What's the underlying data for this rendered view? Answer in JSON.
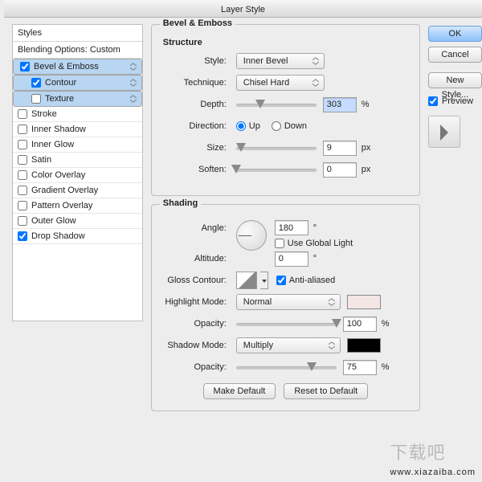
{
  "title": "Layer Style",
  "styles": {
    "head": "Styles",
    "blending": "Blending Options: Custom",
    "items": [
      {
        "label": "Bevel & Emboss",
        "checked": true,
        "sel": true
      },
      {
        "label": "Contour",
        "checked": true,
        "sel": true,
        "indent": 1
      },
      {
        "label": "Texture",
        "checked": false,
        "sel": true,
        "indent": 1
      },
      {
        "label": "Stroke",
        "checked": false
      },
      {
        "label": "Inner Shadow",
        "checked": false
      },
      {
        "label": "Inner Glow",
        "checked": false
      },
      {
        "label": "Satin",
        "checked": false
      },
      {
        "label": "Color Overlay",
        "checked": false
      },
      {
        "label": "Gradient Overlay",
        "checked": false
      },
      {
        "label": "Pattern Overlay",
        "checked": false
      },
      {
        "label": "Outer Glow",
        "checked": false
      },
      {
        "label": "Drop Shadow",
        "checked": true
      }
    ]
  },
  "bevel": {
    "group": "Bevel & Emboss",
    "structure": {
      "title": "Structure",
      "style_label": "Style:",
      "style_value": "Inner Bevel",
      "technique_label": "Technique:",
      "technique_value": "Chisel Hard",
      "depth_label": "Depth:",
      "depth_value": "303",
      "depth_unit": "%",
      "direction_label": "Direction:",
      "up": "Up",
      "down": "Down",
      "direction_value": "up",
      "size_label": "Size:",
      "size_value": "9",
      "size_unit": "px",
      "soften_label": "Soften:",
      "soften_value": "0",
      "soften_unit": "px"
    },
    "shading": {
      "title": "Shading",
      "angle_label": "Angle:",
      "angle_value": "180",
      "deg": "°",
      "use_global": "Use Global Light",
      "use_global_checked": false,
      "altitude_label": "Altitude:",
      "altitude_value": "0",
      "gloss_label": "Gloss Contour:",
      "aa": "Anti-aliased",
      "aa_checked": true,
      "highlight_label": "Highlight Mode:",
      "highlight_value": "Normal",
      "highlight_color": "#f5e6e6",
      "hl_opacity_label": "Opacity:",
      "hl_opacity": "100",
      "pct": "%",
      "shadow_label": "Shadow Mode:",
      "shadow_value": "Multiply",
      "shadow_color": "#000000",
      "sh_opacity_label": "Opacity:",
      "sh_opacity": "75"
    },
    "make_default": "Make Default",
    "reset_default": "Reset to Default"
  },
  "right": {
    "ok": "OK",
    "cancel": "Cancel",
    "new_style": "New Style...",
    "preview": "Preview"
  },
  "watermark": {
    "brand": "下载吧",
    "url": "www.xiazaiba.com"
  }
}
